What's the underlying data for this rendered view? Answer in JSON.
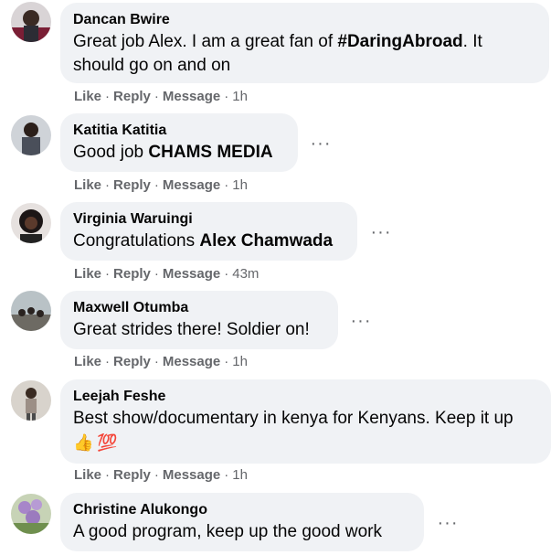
{
  "comments": [
    {
      "author": "Dancan Bwire",
      "text_before": "Great job Alex. I am a great fan of ",
      "tag": "#DaringAbroad",
      "text_after": ". It should go on and on",
      "actions": {
        "like": "Like",
        "reply": "Reply",
        "message": "Message",
        "time": "1h"
      }
    },
    {
      "author": "Katitia Katitia",
      "text_before": "Good job ",
      "mention": "CHAMS MEDIA",
      "actions": {
        "like": "Like",
        "reply": "Reply",
        "message": "Message",
        "time": "1h"
      },
      "more": "···"
    },
    {
      "author": "Virginia Waruingi",
      "text_before": "Congratulations ",
      "mention": "Alex Chamwada",
      "actions": {
        "like": "Like",
        "reply": "Reply",
        "message": "Message",
        "time": "43m"
      },
      "more": "···"
    },
    {
      "author": "Maxwell Otumba",
      "text": "Great strides there! Soldier on!",
      "actions": {
        "like": "Like",
        "reply": "Reply",
        "message": "Message",
        "time": "1h"
      },
      "more": "···"
    },
    {
      "author": "Leejah Feshe",
      "text": "Best show/documentary in kenya for Kenyans. Keep it up",
      "emoji_1": "👍",
      "emoji_2": "💯",
      "actions": {
        "like": "Like",
        "reply": "Reply",
        "message": "Message",
        "time": "1h"
      }
    },
    {
      "author": "Christine Alukongo",
      "text": "A good program, keep up the good work",
      "more": "···"
    }
  ],
  "separator": "·"
}
